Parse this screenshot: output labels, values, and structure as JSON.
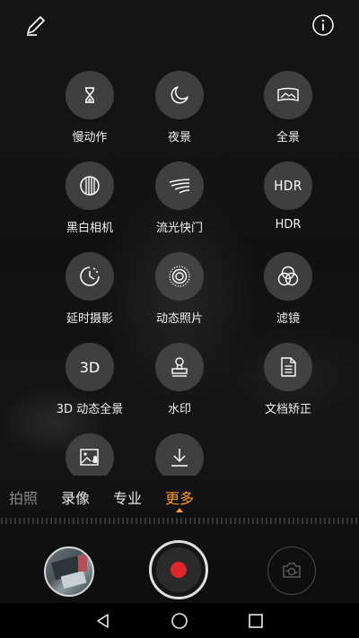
{
  "top_bar": {
    "edit_icon": "pencil-icon",
    "info_icon": "info-icon"
  },
  "modes": [
    {
      "label": "慢动作",
      "icon": "hourglass-icon"
    },
    {
      "label": "夜景",
      "icon": "moon-icon"
    },
    {
      "label": "全景",
      "icon": "panorama-icon"
    },
    {
      "label": "黑白相机",
      "icon": "monochrome-icon"
    },
    {
      "label": "流光快门",
      "icon": "light-trail-icon"
    },
    {
      "label": "HDR",
      "icon": "hdr-icon",
      "icon_text": "HDR"
    },
    {
      "label": "延时摄影",
      "icon": "timelapse-icon"
    },
    {
      "label": "动态照片",
      "icon": "moving-picture-icon"
    },
    {
      "label": "滤镜",
      "icon": "filter-icon"
    },
    {
      "label": "3D 动态全景",
      "icon": "3d-panorama-icon",
      "icon_text": "3D"
    },
    {
      "label": "水印",
      "icon": "stamp-icon"
    },
    {
      "label": "文档矫正",
      "icon": "document-icon"
    },
    {
      "label": "",
      "icon": "image-audio-icon"
    },
    {
      "label": "",
      "icon": "download-icon"
    }
  ],
  "tabs": [
    {
      "label": "拍照",
      "state": "dim"
    },
    {
      "label": "录像",
      "state": "normal"
    },
    {
      "label": "专业",
      "state": "normal"
    },
    {
      "label": "更多",
      "state": "active"
    }
  ],
  "colors": {
    "accent": "#ff9a1a",
    "shutter_dot": "#e0242c"
  },
  "bottom_controls": {
    "thumbnail": "gallery-thumbnail",
    "shutter": "record-shutter",
    "switch": "switch-camera-icon"
  },
  "navbar": {
    "back": "back-triangle-icon",
    "home": "home-circle-icon",
    "recents": "recents-square-icon"
  }
}
